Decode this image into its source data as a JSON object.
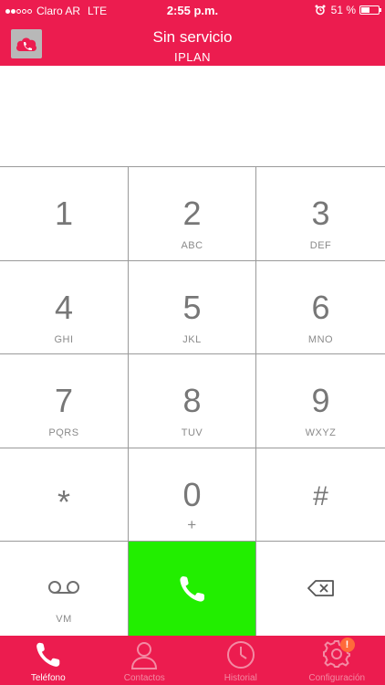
{
  "status_bar": {
    "carrier": "Claro AR",
    "network": "LTE",
    "time": "2:55 p.m.",
    "battery": "51 %",
    "battery_level": 0.51,
    "signal_bars": 2
  },
  "header": {
    "title": "Sin servicio",
    "subtitle": "IPLAN",
    "logo_icon": "cloud-phone-icon"
  },
  "keypad": {
    "keys": [
      {
        "digit": "1",
        "letters": ""
      },
      {
        "digit": "2",
        "letters": "ABC"
      },
      {
        "digit": "3",
        "letters": "DEF"
      },
      {
        "digit": "4",
        "letters": "GHI"
      },
      {
        "digit": "5",
        "letters": "JKL"
      },
      {
        "digit": "6",
        "letters": "MNO"
      },
      {
        "digit": "7",
        "letters": "PQRS"
      },
      {
        "digit": "8",
        "letters": "TUV"
      },
      {
        "digit": "9",
        "letters": "WXYZ"
      },
      {
        "digit": "*",
        "letters": ""
      },
      {
        "digit": "0",
        "letters": "+"
      },
      {
        "digit": "#",
        "letters": ""
      }
    ],
    "voicemail_label": "VM",
    "call_icon": "phone-icon",
    "delete_icon": "backspace-icon"
  },
  "tabbar": {
    "tabs": [
      {
        "label": "Teléfono",
        "icon": "phone-icon",
        "active": true
      },
      {
        "label": "Contactos",
        "icon": "person-icon",
        "active": false
      },
      {
        "label": "Historial",
        "icon": "clock-icon",
        "active": false
      },
      {
        "label": "Configuración",
        "icon": "gear-icon",
        "active": false
      }
    ],
    "settings_badge": "!"
  },
  "colors": {
    "brand": "#ec1c4f",
    "call_green": "#22ee00"
  }
}
